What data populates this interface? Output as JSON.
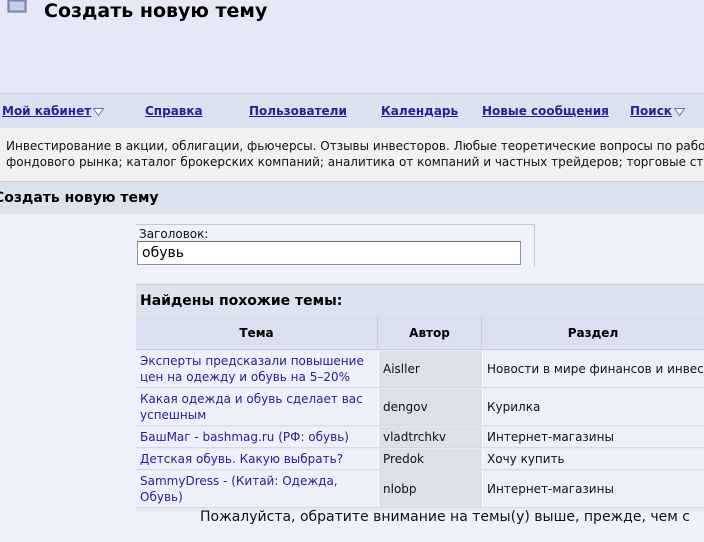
{
  "page": {
    "title": "Создать новую тему"
  },
  "nav": {
    "items": [
      {
        "label": "Мой кабинет"
      },
      {
        "label": "Справка"
      },
      {
        "label": "Пользователи"
      },
      {
        "label": "Календарь"
      },
      {
        "label": "Новые сообщения"
      },
      {
        "label": "Поиск"
      }
    ]
  },
  "forum": {
    "description_line1": "Инвестирование в акции, облигации, фьючерсы. Отзывы инвесторов. Любые теоретические вопросы по работ",
    "description_line2": "фондового рынка; каталог брокерских компаний; аналитика от компаний и частных трейдеров; торговые стр"
  },
  "form": {
    "section_title": "Создать новую тему",
    "title_label": "Заголовок:",
    "title_value": "обувь"
  },
  "similar": {
    "heading": "Найдены похожие темы:",
    "columns": [
      "Тема",
      "Автор",
      "Раздел"
    ],
    "rows": [
      {
        "topic": "Эксперты предсказали повышение цен на одежду и обувь на 5–20%",
        "author": "Aisller",
        "section": "Новости в мире финансов и инвест"
      },
      {
        "topic": "Какая одежда и обувь сделает вас успешным",
        "author": "dengov",
        "section": "Курилка"
      },
      {
        "topic": "БашМаг - bashmag.ru (РФ: обувь)",
        "author": "vladtrchkv",
        "section": "Интернет-магазины"
      },
      {
        "topic": "Детская обувь. Какую выбрать?",
        "author": "Predok",
        "section": "Хочу купить"
      },
      {
        "topic": "SammyDress - (Китай: Одежда, Обувь)",
        "author": "nlobp",
        "section": "Интернет-магазины"
      }
    ],
    "notice": "Пожалуйста, обратите внимание на темы(у) выше, прежде, чем с"
  },
  "colors": {
    "link": "#22229c",
    "background": "#e6e8f5"
  },
  "icons": {
    "page": "folder-icon",
    "dropdown": "chevron-down-icon"
  }
}
